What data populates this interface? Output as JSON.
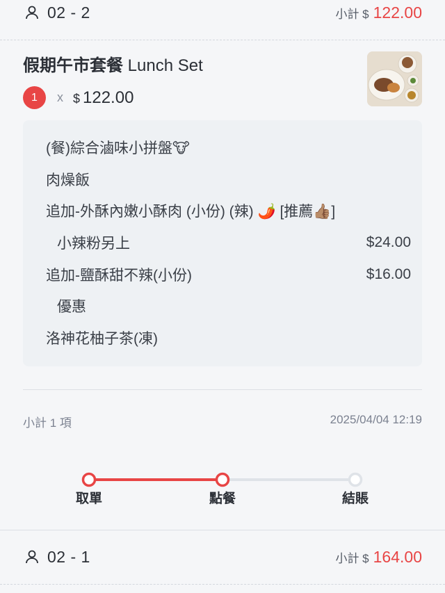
{
  "order_top": {
    "table": "02 - 2",
    "subtotal_label": "小計 $",
    "subtotal_amount": "122.00"
  },
  "item": {
    "title_zh": "假期午市套餐",
    "title_en": "Lunch Set",
    "quantity": "1",
    "times": "x",
    "currency": "$",
    "unit_price": "122.00",
    "options": [
      {
        "label": "(餐)綜合滷味小拼盤🐮",
        "price": ""
      },
      {
        "label": "肉燥飯",
        "price": ""
      },
      {
        "label": "追加-外酥內嫩小酥肉 (小份) (辣) 🌶️ [推薦👍🏽]",
        "price": ""
      },
      {
        "label": "小辣粉另上",
        "price": "$24.00"
      },
      {
        "label": "追加-鹽酥甜不辣(小份)",
        "price": "$16.00"
      },
      {
        "label": "優惠",
        "price": ""
      },
      {
        "label": "洛神花柚子茶(凍)",
        "price": ""
      }
    ]
  },
  "summary": {
    "count_text": "小計 1 項",
    "timestamp": "2025/04/04 12:19"
  },
  "progress": {
    "steps": [
      "取單",
      "點餐",
      "結賬"
    ],
    "completed_steps": 2,
    "active_color": "#e84545",
    "inactive_color": "#dfe3e8"
  },
  "order_bottom": {
    "table": "02 - 1",
    "subtotal_label": "小計 $",
    "subtotal_amount": "164.00"
  },
  "icons": {
    "person": "person-icon",
    "food_thumbnail": "food-photo"
  }
}
